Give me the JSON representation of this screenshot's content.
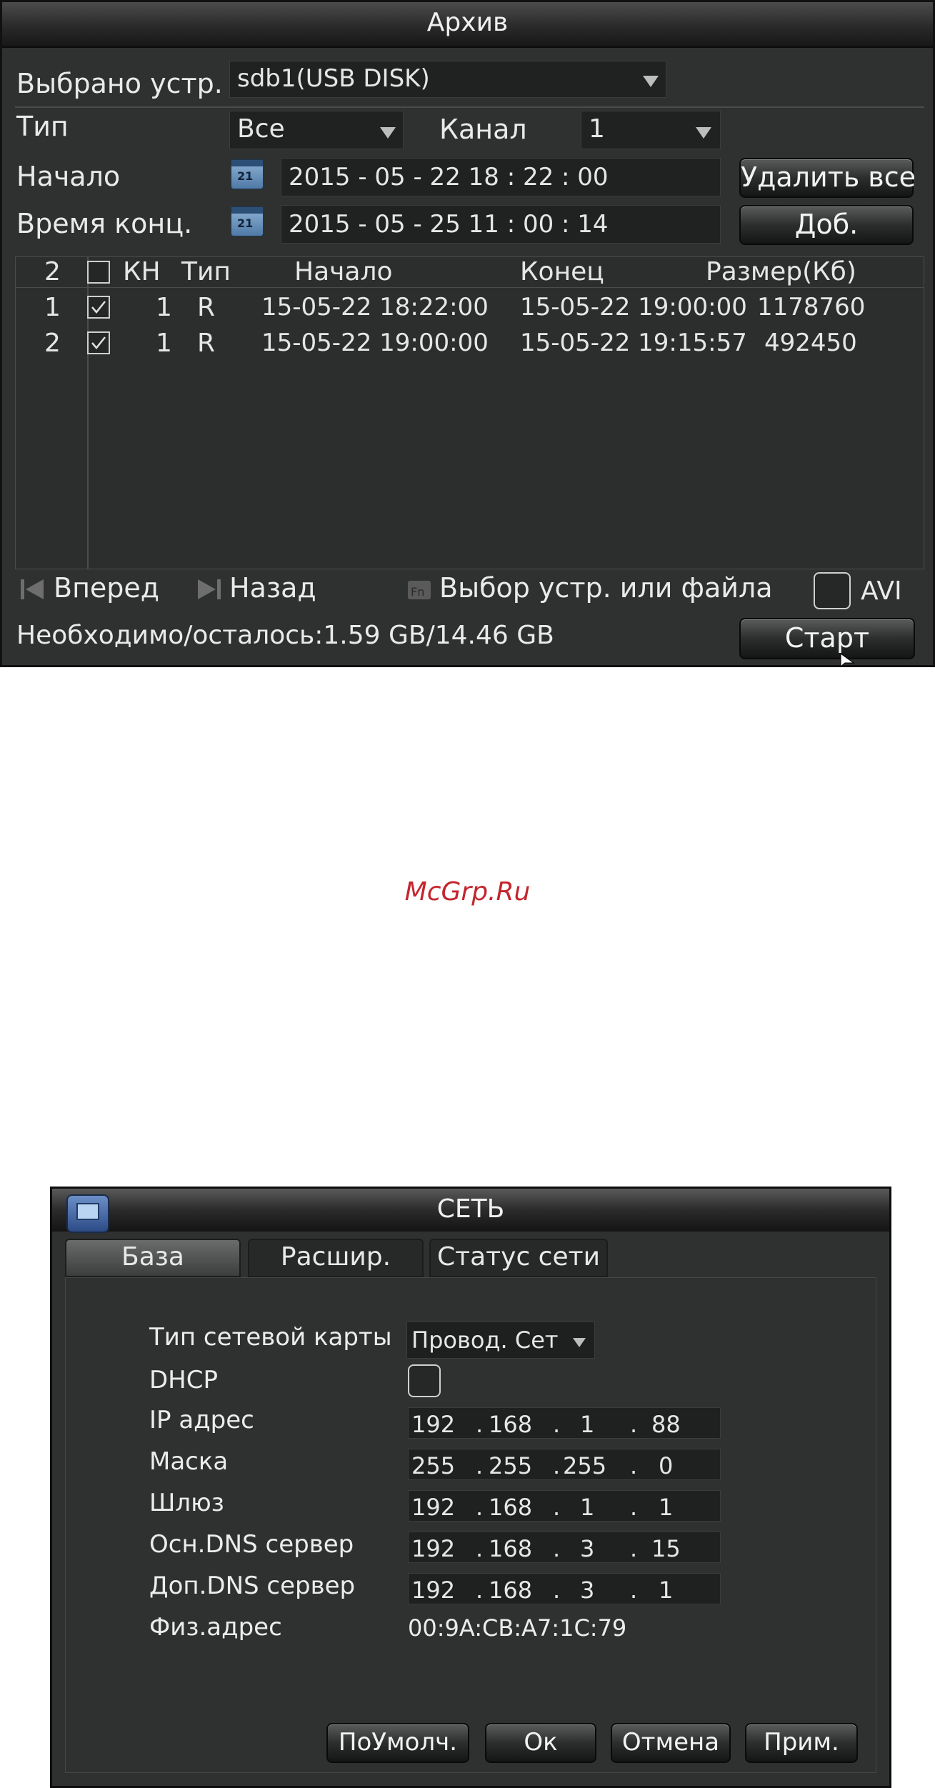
{
  "archive": {
    "title": "Архив",
    "device_label": "Выбрано устр.",
    "device_value": "sdb1(USB DISK)",
    "type_label": "Тип",
    "type_value": "Все",
    "channel_label": "Канал",
    "channel_value": "1",
    "start_label": "Начало",
    "start_value": "2015  - 05 - 22   18 : 22 : 00",
    "end_label": "Время конц.",
    "end_value": "2015  - 05 - 25   11 : 00 : 14",
    "calendar_icon_text": "21",
    "delete_all_button": "Удалить все",
    "add_button": "Доб.",
    "table": {
      "count": "2",
      "headers": {
        "ch": "КН",
        "type": "Тип",
        "start": "Начало",
        "end": "Конец",
        "size": "Размер(Кб)"
      },
      "rows": [
        {
          "num": "1",
          "checked": true,
          "ch": "1",
          "type": "R",
          "start": "15-05-22 18:22:00",
          "end": "15-05-22 19:00:00",
          "size": "1178760"
        },
        {
          "num": "2",
          "checked": true,
          "ch": "1",
          "type": "R",
          "start": "15-05-22 19:00:00",
          "end": "15-05-22 19:15:57",
          "size": "492450"
        }
      ]
    },
    "forward_label": "Вперед",
    "back_label": "Назад",
    "select_label": "Выбор устр. или файла",
    "avi_label": "AVI",
    "avi_checked": false,
    "status_text": "Необходимо/осталось:1.59 GB/14.46 GB",
    "start_button": "Старт"
  },
  "watermark": "McGrp.Ru",
  "network": {
    "title": "СЕТЬ",
    "tabs": [
      "База",
      "Расшир.",
      "Статус сети"
    ],
    "active_tab": 0,
    "nic_type_label": "Тип сетевой карты",
    "nic_type_value": "Провод. Сет",
    "dhcp_label": "DHCP",
    "dhcp_checked": false,
    "ip_label": "IP адрес",
    "ip": [
      "192",
      "168",
      "1",
      "88"
    ],
    "mask_label": "Маска",
    "mask": [
      "255",
      "255",
      "255",
      "0"
    ],
    "gateway_label": "Шлюз",
    "gateway": [
      "192",
      "168",
      "1",
      "1"
    ],
    "dns1_label": "Осн.DNS сервер",
    "dns1": [
      "192",
      "168",
      "3",
      "15"
    ],
    "dns2_label": "Доп.DNS сервер",
    "dns2": [
      "192",
      "168",
      "3",
      "1"
    ],
    "mac_label": "Физ.адрес",
    "mac_value": "00:9A:CB:A7:1C:79",
    "buttons": {
      "default": "ПоУмолч.",
      "ok": "Ок",
      "cancel": "Отмена",
      "apply": "Прим."
    }
  },
  "colors": {
    "window_bg": "#2f3130",
    "field_bg": "#202221",
    "watermark": "#c4262e",
    "text": "#e6e6e6"
  }
}
